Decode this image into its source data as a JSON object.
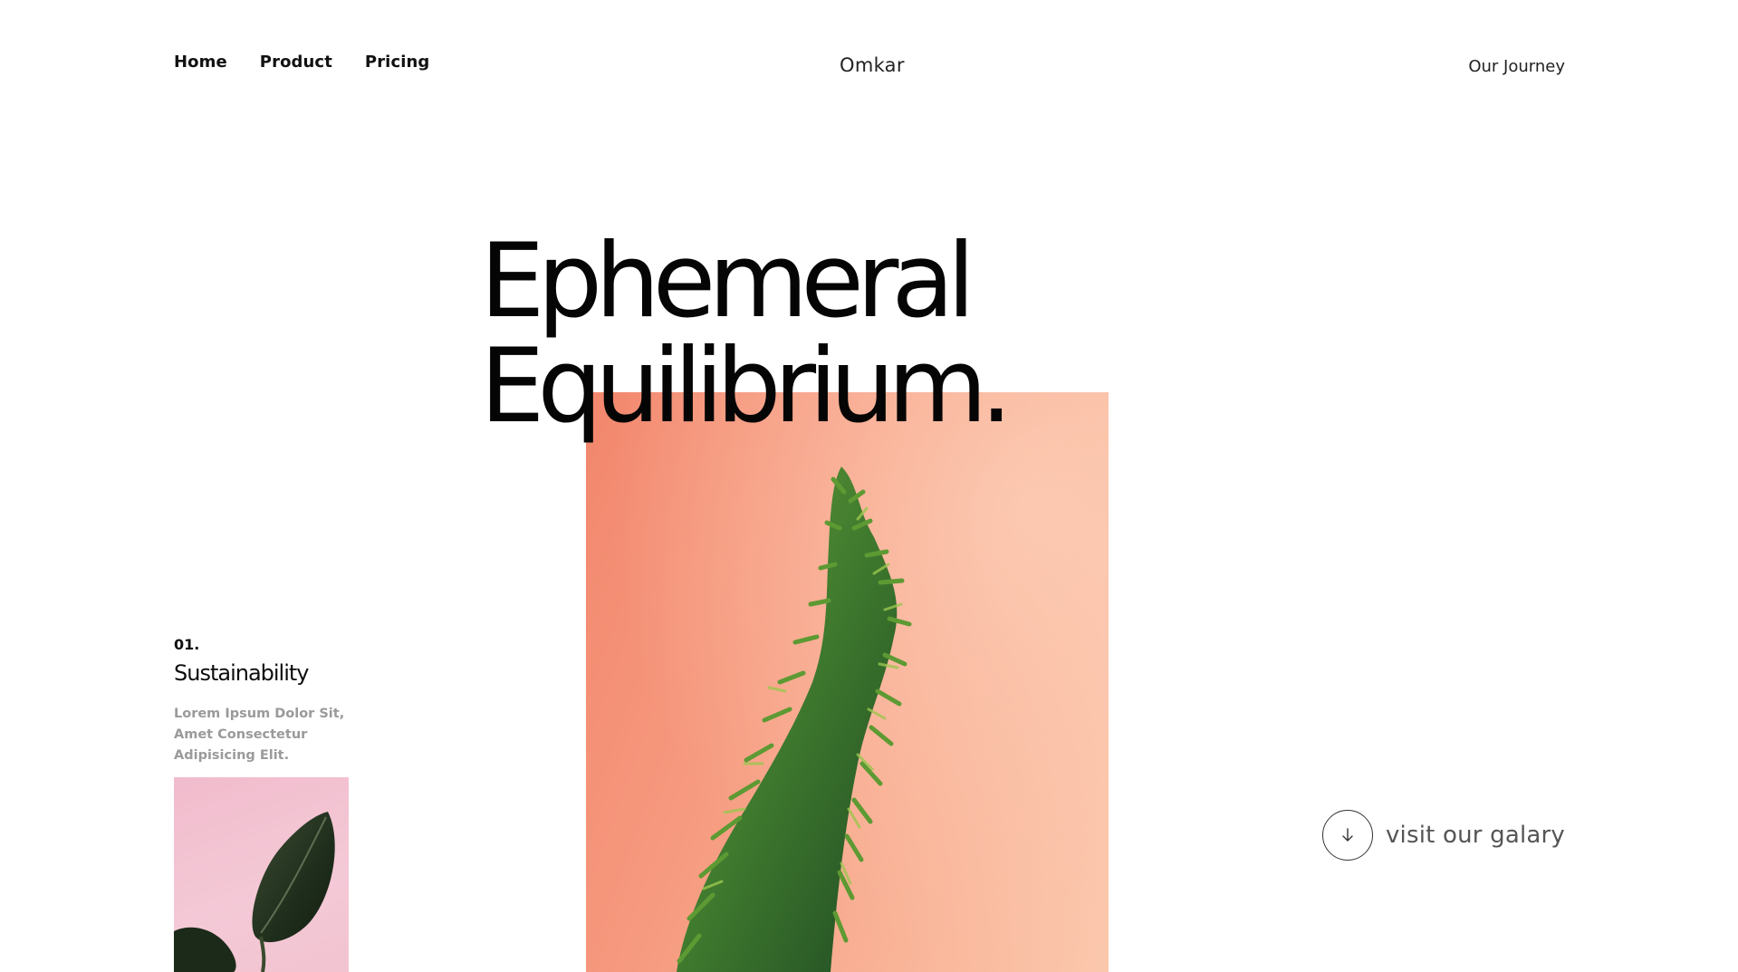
{
  "nav": {
    "links": [
      {
        "label": "Home"
      },
      {
        "label": "Product"
      },
      {
        "label": "Pricing"
      }
    ],
    "brand": "Omkar",
    "journey": "Our Journey"
  },
  "hero": {
    "line1": "Ephemeral",
    "line2": "Equilibrium.",
    "image_icon": "coral-plant-photo",
    "image_colors": {
      "background": "#f69a7f",
      "plant": "#3f7a2e"
    }
  },
  "feature": {
    "number": "01.",
    "title": "Sustainability",
    "description": "Lorem Ipsum Dolor Sit, Amet Consectetur Adipisicing Elit.",
    "image_icon": "pink-leaf-photo",
    "image_colors": {
      "background": "#f3c4d2",
      "leaf": "#1f2e1c"
    }
  },
  "gallery": {
    "label": "visit our galary",
    "icon": "arrow-down-icon"
  }
}
